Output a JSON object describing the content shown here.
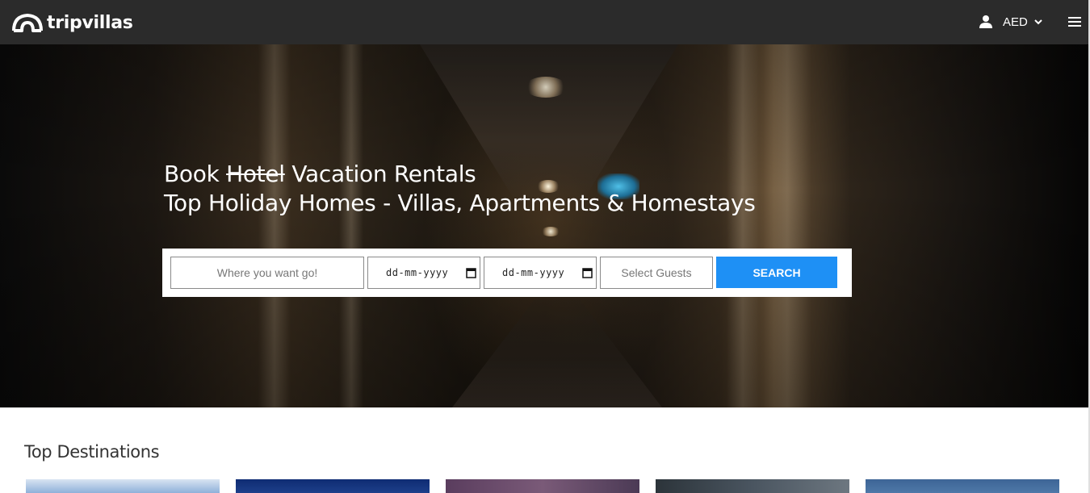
{
  "header": {
    "logo_text": "tripvillas",
    "currency": "AED",
    "icons": [
      "tripvillas-logo-icon",
      "user-icon",
      "chevron-down-icon",
      "hamburger-menu-icon"
    ]
  },
  "hero": {
    "line1_before": "Book ",
    "line1_strike": "Hotel",
    "line1_after": " Vacation Rentals",
    "line2": "Top Holiday Homes - Villas, Apartments & Homestays"
  },
  "search": {
    "destination_placeholder": "Where you want go!",
    "checkin_value": "dd-mm-yyyy",
    "checkout_value": "dd-mm-yyyy",
    "guests_placeholder": "Select Guests",
    "button_label": "SEARCH"
  },
  "destinations": {
    "title": "Top Destinations",
    "card_colors": [
      "#8fb0d9",
      "#1d3f8a",
      "#7a5a78",
      "#4a5560",
      "#4f78a8"
    ]
  },
  "colors": {
    "header_bg": "#2b2b2b",
    "accent": "#1e90f5"
  }
}
